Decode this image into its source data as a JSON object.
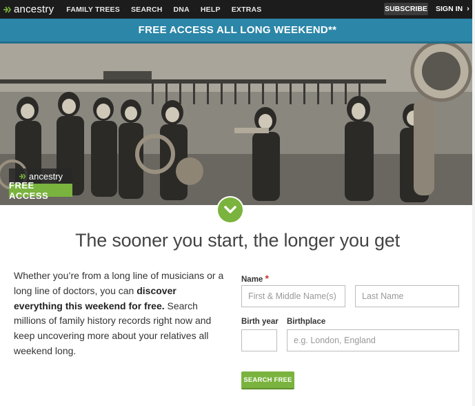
{
  "nav": {
    "logo_text": "ancestry",
    "links": [
      "FAMILY TREES",
      "SEARCH",
      "DNA",
      "HELP",
      "EXTRAS"
    ],
    "subscribe_label": "SUBSCRIBE",
    "signin_label": "SIGN IN"
  },
  "banner": {
    "text": "FREE ACCESS ALL LONG WEEKEND**"
  },
  "hero": {
    "badge_logo": "ancestry",
    "badge_text": "FREE ACCESS"
  },
  "headline": "The sooner you start, the longer you get",
  "intro": {
    "part1": "Whether you’re from a long line of musicians or a long line of doctors, you can ",
    "bold": "discover everything this weekend for free.",
    "part2": " Search millions of family history records right now and keep uncovering more about your relatives all weekend long."
  },
  "form": {
    "name_label": "Name",
    "required_mark": "*",
    "first_placeholder": "First & Middle Name(s)",
    "last_placeholder": "Last Name",
    "birth_year_label": "Birth year",
    "birthplace_label": "Birthplace",
    "birthplace_placeholder": "e.g. London, England",
    "search_button": "SEARCH FREE"
  },
  "colors": {
    "nav_bg": "#1c1c1c",
    "banner_bg": "#2c86a8",
    "accent_green": "#7ab33e"
  }
}
